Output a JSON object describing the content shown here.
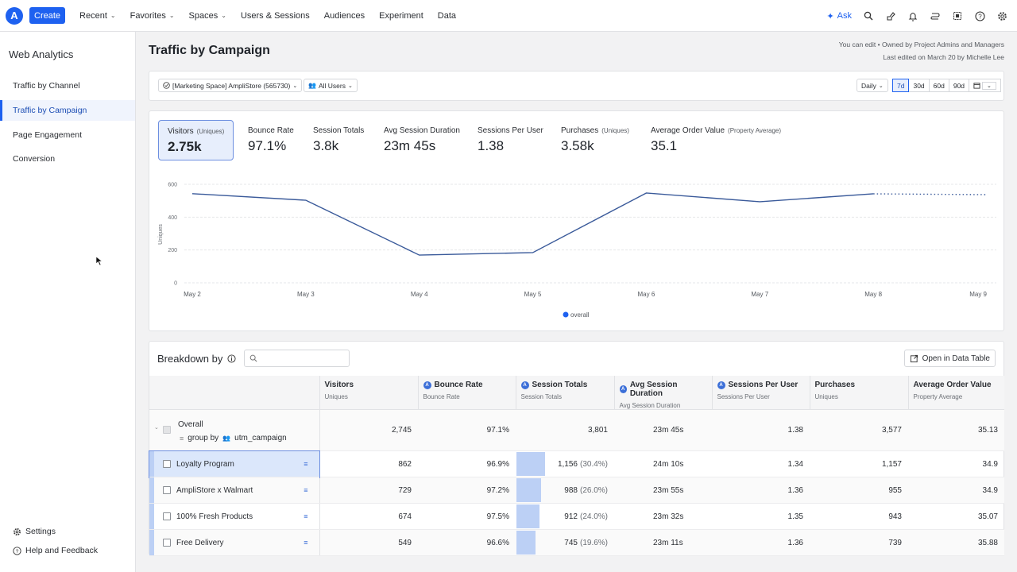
{
  "nav": {
    "logo": "A",
    "create": "Create",
    "items": [
      {
        "label": "Recent",
        "dropdown": true
      },
      {
        "label": "Favorites",
        "dropdown": true
      },
      {
        "label": "Spaces",
        "dropdown": true
      },
      {
        "label": "Users & Sessions",
        "dropdown": false
      },
      {
        "label": "Audiences",
        "dropdown": false
      },
      {
        "label": "Experiment",
        "dropdown": false
      },
      {
        "label": "Data",
        "dropdown": false
      }
    ],
    "ask": "Ask",
    "icons": [
      "search-icon",
      "rocket-icon",
      "bell-icon",
      "switch-icon",
      "grid-icon",
      "help-icon",
      "gear-icon"
    ]
  },
  "sidebar": {
    "title": "Web Analytics",
    "items": [
      {
        "label": "Traffic by Channel",
        "active": false
      },
      {
        "label": "Traffic by Campaign",
        "active": true
      },
      {
        "label": "Page Engagement",
        "active": false
      },
      {
        "label": "Conversion",
        "active": false
      }
    ],
    "settings": "Settings",
    "help": "Help and Feedback"
  },
  "page": {
    "title": "Traffic by Campaign",
    "meta_line1": "You can edit • Owned by Project Admins and Managers",
    "meta_line2": "Last edited on March 20 by Michelle Lee"
  },
  "filters": {
    "project": "[Marketing Space] AmpliStore (565730)",
    "segment": "All Users",
    "interval": "Daily",
    "ranges": [
      "7d",
      "30d",
      "60d",
      "90d"
    ],
    "selected_range": "7d"
  },
  "kpis": [
    {
      "label": "Visitors",
      "sub": "(Uniques)",
      "value": "2.75k",
      "selected": true
    },
    {
      "label": "Bounce Rate",
      "sub": "",
      "value": "97.1%",
      "selected": false
    },
    {
      "label": "Session Totals",
      "sub": "",
      "value": "3.8k",
      "selected": false
    },
    {
      "label": "Avg Session Duration",
      "sub": "",
      "value": "23m 45s",
      "selected": false
    },
    {
      "label": "Sessions Per User",
      "sub": "",
      "value": "1.38",
      "selected": false
    },
    {
      "label": "Purchases",
      "sub": "(Uniques)",
      "value": "3.58k",
      "selected": false
    },
    {
      "label": "Average Order Value",
      "sub": "(Property Average)",
      "value": "35.1",
      "selected": false
    }
  ],
  "chart_data": {
    "type": "line",
    "title": "",
    "xlabel": "",
    "ylabel": "Uniques",
    "categories": [
      "May 2",
      "May 3",
      "May 4",
      "May 5",
      "May 6",
      "May 7",
      "May 8",
      "May 9"
    ],
    "series": [
      {
        "name": "overall",
        "values": [
          543,
          503,
          169,
          184,
          547,
          494,
          542,
          537
        ],
        "color": "#3a5a9a",
        "incomplete_from_index": 6
      }
    ],
    "yticks": [
      0,
      200,
      400,
      600
    ],
    "ylim": [
      0,
      600
    ],
    "grid": true,
    "legend": "bottom-center",
    "legend_color": "#1e61f0"
  },
  "breakdown": {
    "title": "Breakdown by",
    "search_placeholder": "",
    "open_button": "Open in Data Table",
    "columns": [
      {
        "title": "Visitors",
        "sub": "Uniques",
        "icon": false
      },
      {
        "title": "Bounce Rate",
        "sub": "Bounce Rate",
        "icon": true
      },
      {
        "title": "Session Totals",
        "sub": "Session Totals",
        "icon": true
      },
      {
        "title": "Avg Session Duration",
        "sub": "Avg Session Duration",
        "icon": true
      },
      {
        "title": "Sessions Per User",
        "sub": "Sessions Per User",
        "icon": true
      },
      {
        "title": "Purchases",
        "sub": "Uniques",
        "icon": false
      },
      {
        "title": "Average Order Value",
        "sub": "Property Average",
        "icon": false
      }
    ],
    "overall": {
      "label": "Overall",
      "group_by": "group by",
      "group_prop": "utm_campaign",
      "values": [
        "2,745",
        "97.1%",
        "3,801",
        "23m  45s",
        "1.38",
        "3,577",
        "35.13"
      ]
    },
    "rows": [
      {
        "label": "Loyalty Program",
        "visitors": "862",
        "bounce": "96.9%",
        "sessions": "1,156",
        "sessions_pct": "(30.4%)",
        "sessions_share": 0.304,
        "duration": "24m  10s",
        "spu": "1.34",
        "purchases": "1,157",
        "aov": "34.9",
        "selected": true
      },
      {
        "label": "AmpliStore x Walmart",
        "visitors": "729",
        "bounce": "97.2%",
        "sessions": "988",
        "sessions_pct": "(26.0%)",
        "sessions_share": 0.26,
        "duration": "23m  55s",
        "spu": "1.36",
        "purchases": "955",
        "aov": "34.9",
        "selected": false
      },
      {
        "label": "100% Fresh Products",
        "visitors": "674",
        "bounce": "97.5%",
        "sessions": "912",
        "sessions_pct": "(24.0%)",
        "sessions_share": 0.24,
        "duration": "23m  32s",
        "spu": "1.35",
        "purchases": "943",
        "aov": "35.07",
        "selected": false
      },
      {
        "label": "Free Delivery",
        "visitors": "549",
        "bounce": "96.6%",
        "sessions": "745",
        "sessions_pct": "(19.6%)",
        "sessions_share": 0.196,
        "duration": "23m  11s",
        "spu": "1.36",
        "purchases": "739",
        "aov": "35.88",
        "selected": false
      }
    ]
  }
}
